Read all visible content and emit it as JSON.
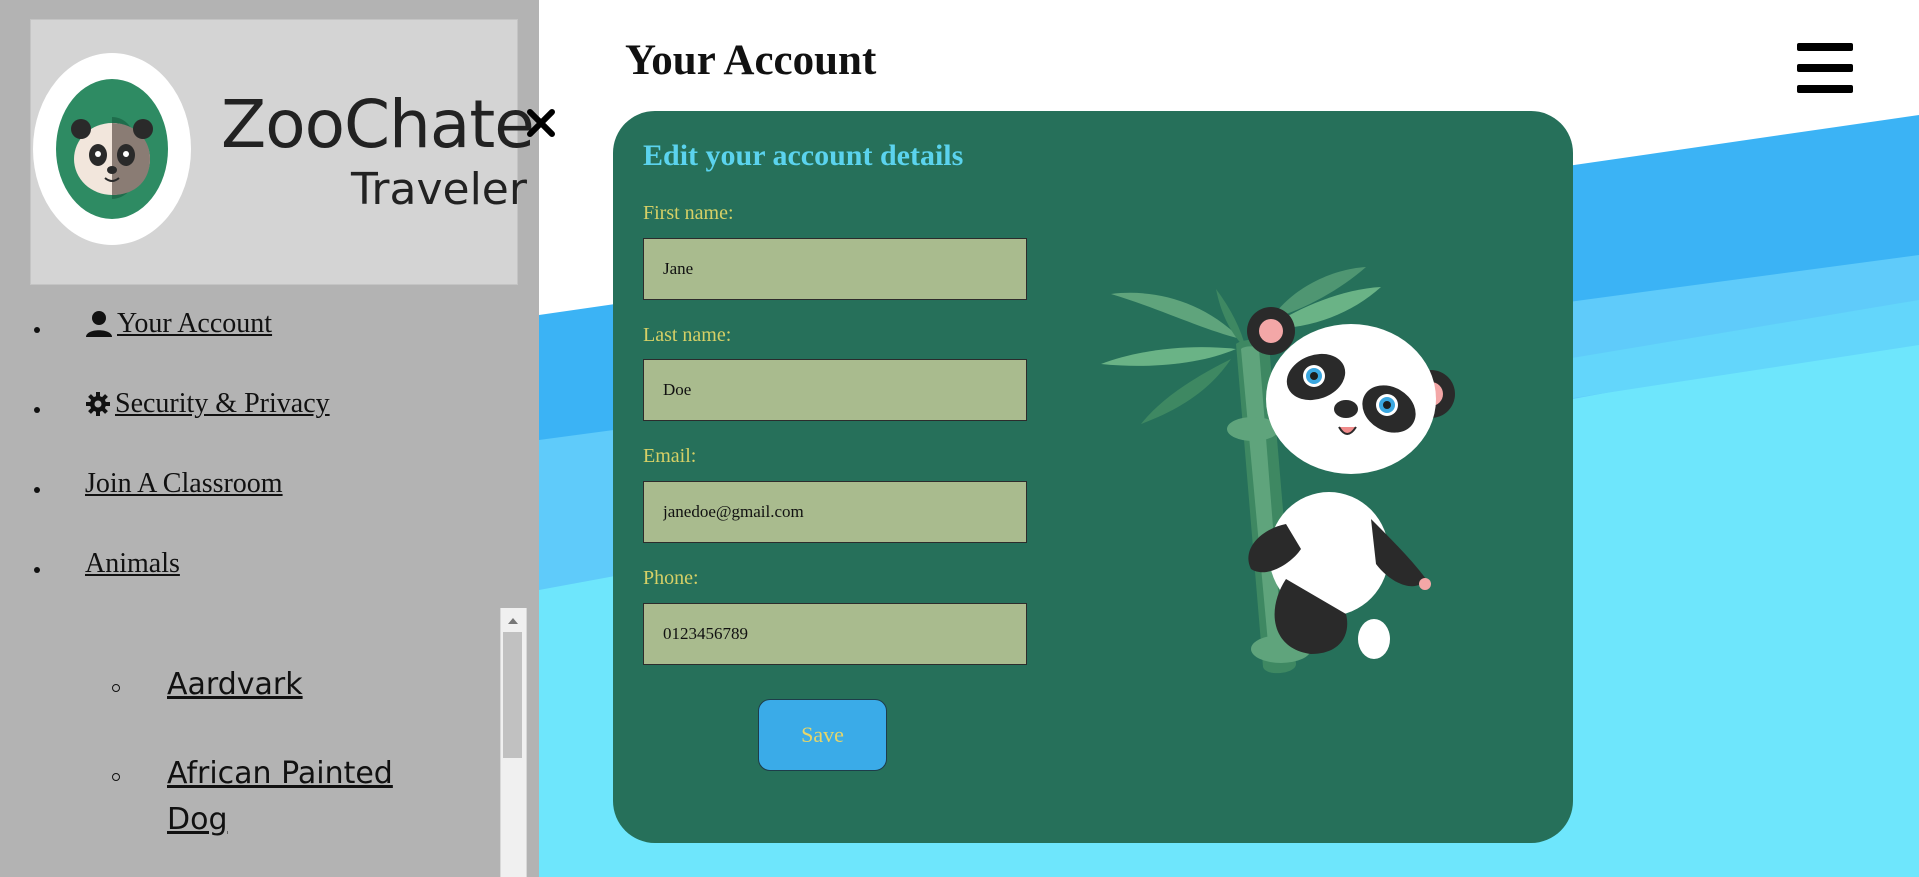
{
  "sidebar": {
    "logo": {
      "title": "ZooChater",
      "subtitle": "Traveler"
    },
    "close_symbol": "×",
    "nav": [
      {
        "label": "Your Account",
        "icon": "person-icon"
      },
      {
        "label": "Security & Privacy",
        "icon": "gear-icon"
      },
      {
        "label": "Join A Classroom",
        "icon": ""
      },
      {
        "label": "Animals",
        "icon": ""
      }
    ],
    "animals": [
      {
        "label": "Aardvark"
      },
      {
        "label": "African Painted Dog"
      }
    ]
  },
  "header": {
    "title": "Your Account",
    "menu_icon": "hamburger-icon"
  },
  "form": {
    "heading": "Edit your account details",
    "fields": [
      {
        "label": "First name:",
        "value": "Jane"
      },
      {
        "label": "Last name:",
        "value": "Doe"
      },
      {
        "label": "Email:",
        "value": "janedoe@gmail.com"
      },
      {
        "label": "Phone:",
        "value": "0123456789"
      }
    ],
    "save_label": "Save"
  },
  "colors": {
    "sidebar_bg": "#b3b3b3",
    "card_bg": "#26705a",
    "heading_color": "#5bd3ee",
    "label_color": "#d6d066",
    "input_bg": "#a9bb8e",
    "save_bg": "#3aabe8",
    "bg_blue": "#3bb3f5",
    "bg_light_blue": "#6ee6fc"
  }
}
